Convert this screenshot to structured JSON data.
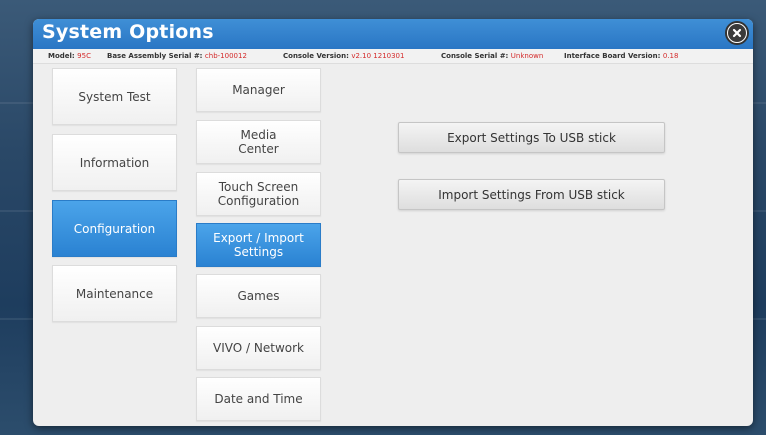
{
  "window": {
    "title": "System Options"
  },
  "info": {
    "model_label": "Model:",
    "model_value": "95C",
    "base_serial_label": "Base Assembly Serial #:",
    "base_serial_value": "chb-100012",
    "console_version_label": "Console Version:",
    "console_version_value": "v2.10 1210301",
    "console_serial_label": "Console Serial #:",
    "console_serial_value": "Unknown",
    "interface_board_label": "Interface Board Version:",
    "interface_board_value": "0.18"
  },
  "categories": [
    {
      "label": "System Test",
      "active": false
    },
    {
      "label": "Information",
      "active": false
    },
    {
      "label": "Configuration",
      "active": true
    },
    {
      "label": "Maintenance",
      "active": false
    }
  ],
  "subitems": [
    {
      "label": "Manager",
      "active": false
    },
    {
      "label": "Media\nCenter",
      "active": false
    },
    {
      "label": "Touch Screen\nConfiguration",
      "active": false
    },
    {
      "label": "Export / Import\nSettings",
      "active": true
    },
    {
      "label": "Games",
      "active": false
    },
    {
      "label": "VIVO / Network",
      "active": false
    },
    {
      "label": "Date and Time",
      "active": false
    }
  ],
  "actions": {
    "export_label": "Export Settings To USB stick",
    "import_label": "Import Settings From USB stick"
  },
  "colors": {
    "accent": "#2a82d2",
    "value_red": "#d42b2b"
  },
  "icons": {
    "close": "close-icon"
  }
}
